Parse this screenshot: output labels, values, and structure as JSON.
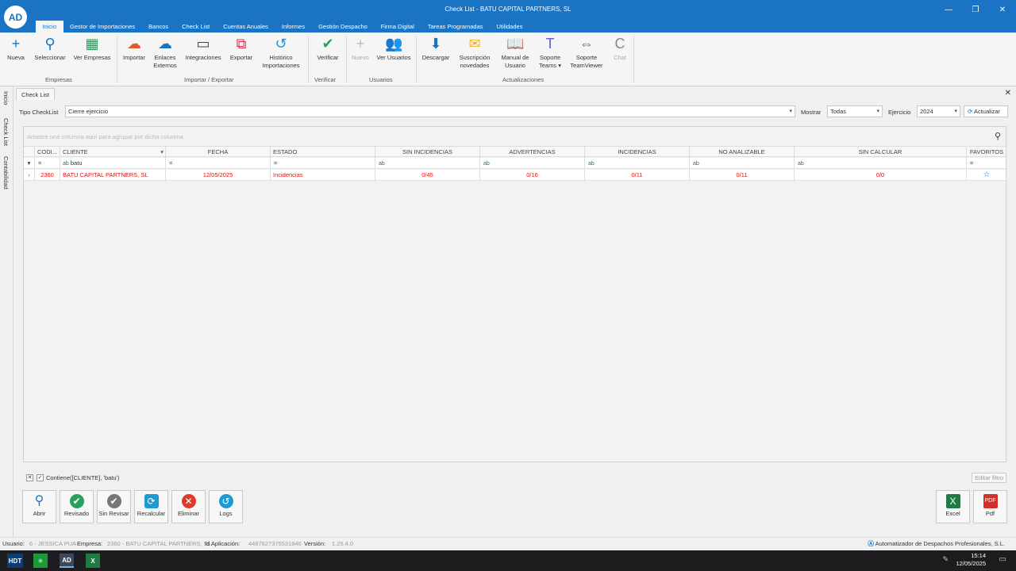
{
  "window": {
    "title": "Check List - BATU CAPITAL PARTNERS, SL",
    "logo": "AD",
    "controls": [
      "—",
      "❐",
      "✕"
    ]
  },
  "menu": [
    "Inicio",
    "Gestor de Importaciones",
    "Bancos",
    "Check List",
    "Cuentas Anuales",
    "Informes",
    "Gestión Despacho",
    "Firma Digital",
    "Tareas Programadas",
    "Utilidades"
  ],
  "ribbon": {
    "buttons": {
      "nueva": "Nueva",
      "seleccionar": "Seleccionar",
      "ver_empresas": "Ver Empresas",
      "importar": "Importar",
      "enlaces": "Enlaces Externos",
      "integraciones": "Integraciones",
      "exportar": "Exportar",
      "historico": "Histórico Importaciones",
      "verificar": "Verificar",
      "nuevo": "Nuevo",
      "ver_usuarios": "Ver Usuarios",
      "descargar": "Descargar",
      "suscripcion": "Suscripción novedades",
      "manual": "Manual de Usuario",
      "soporte_teams": "Soporte Teams ▾",
      "soporte_tv": "Soporte TeamViewer",
      "chat": "Chat"
    },
    "groups": {
      "empresas": "Empresas",
      "importar_exportar": "Importar / Exportar",
      "verificar": "Verificar",
      "usuarios": "Usuarios",
      "actualizaciones": "Actualizaciones"
    }
  },
  "rail": [
    "Inicio",
    "Check List",
    "Contabilidad"
  ],
  "doc_tab": "Check List",
  "filters": {
    "tipo_label": "Tipo CheckList",
    "tipo_value": "Cierre ejercicio",
    "mostrar_label": "Mostrar",
    "mostrar_value": "Todas",
    "ejercicio_label": "Ejercicio",
    "ejercicio_value": "2024",
    "actualizar": "Actualizar"
  },
  "grid": {
    "group_hint": "Arrastre una columna aquí para agrupar por dicha columna",
    "headers": [
      "CODI...",
      "CLIENTE",
      "FECHA",
      "ESTADO",
      "SIN INCIDENCIAS",
      "ADVERTENCIAS",
      "INCIDENCIAS",
      "NO ANALIZABLE",
      "SIN CALCULAR",
      "FAVORITOS"
    ],
    "filter_row": {
      "codi": "=",
      "cliente": "batu",
      "fecha": "=",
      "estado": "=",
      "favoritos": "="
    },
    "rows": [
      {
        "codi": "2360",
        "cliente": "BATU CAPITAL PARTNERS, SL",
        "fecha": "12/05/2025",
        "estado": "Incidencias",
        "sin_incidencias": "0/45",
        "advertencias": "0/16",
        "incidencias": "0/11",
        "no_analizable": "0/11",
        "sin_calcular": "0/0",
        "favorito": "☆"
      }
    ]
  },
  "filter_status": {
    "expression": "Contiene([CLIENTE], 'batu')",
    "edit": "Editar filtro"
  },
  "bottom_buttons": {
    "abrir": "Abrir",
    "revisado": "Revisado",
    "sin_revisar": "Sin Revisar",
    "recalcular": "Recalcular",
    "eliminar": "Eliminar",
    "logs": "Logs",
    "excel": "Excel",
    "pdf": "Pdf"
  },
  "status": {
    "usuario_label": "Usuario:",
    "usuario_value": "6 - JESSICA PUA",
    "empresa_label": "Empresa:",
    "empresa_value": "2360 - BATU CAPITAL PARTNERS, SL",
    "id_label": "Id Aplicación:",
    "id_value": "4487627375531846",
    "version_label": "Versión:",
    "version_value": "1.25.4.0",
    "brand": "Automatizador de Despachos Profesionales, S.L."
  },
  "taskbar": {
    "time": "15:14",
    "date": "12/05/2025"
  }
}
